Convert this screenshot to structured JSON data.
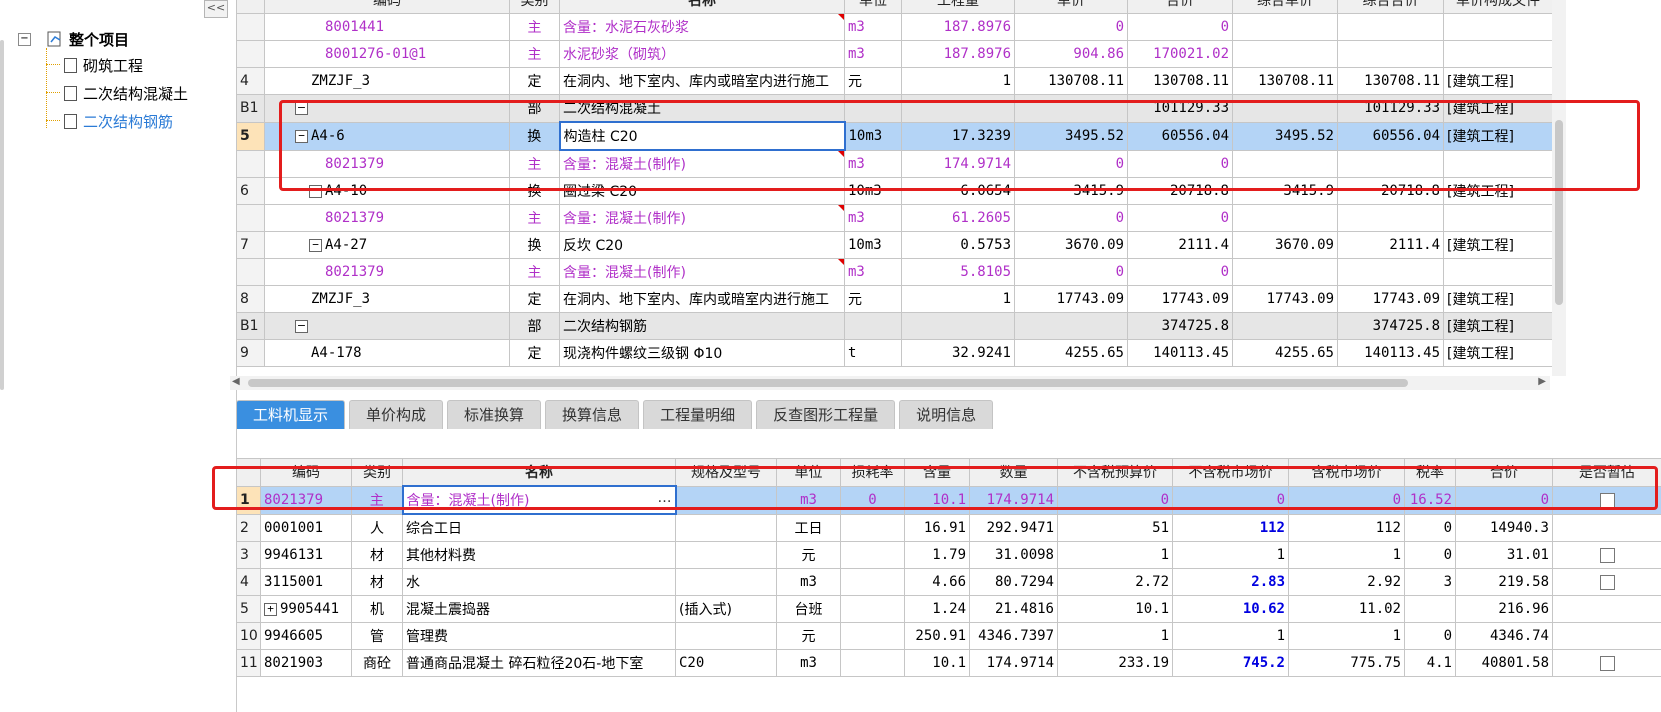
{
  "tree": {
    "collapse_label": "<<",
    "root_label": "整个项目",
    "root_toggle": "−",
    "children": [
      "砌筑工程",
      "二次结构混凝土",
      "二次结构钢筋"
    ]
  },
  "top_table": {
    "headers": [
      "编码",
      "类别",
      "名称",
      "单位",
      "工程量",
      "单价",
      "合价",
      "综合单价",
      "综合合价",
      "单价构成文件"
    ],
    "rows": [
      {
        "no": "",
        "code": "8001441",
        "type": "主",
        "name": "含量：水泥石灰砂浆",
        "unit": "m3",
        "qty": "187.8976",
        "price": "0",
        "total": "0",
        "cprice": "",
        "ctotal": "",
        "file": ""
      },
      {
        "no": "",
        "code": "8001276-01@1",
        "type": "主",
        "name": "水泥砂浆（砌筑）",
        "unit": "m3",
        "qty": "187.8976",
        "price": "904.86",
        "total": "170021.02",
        "cprice": "",
        "ctotal": "",
        "file": ""
      },
      {
        "no": "4",
        "code": "ZMZJF_3",
        "type": "定",
        "name": "在洞内、地下室内、库内或暗室内进行施工",
        "unit": "元",
        "qty": "1",
        "price": "130708.11",
        "total": "130708.11",
        "cprice": "130708.11",
        "ctotal": "130708.11",
        "file": "[建筑工程]"
      },
      {
        "no": "B1",
        "code": "",
        "type": "部",
        "name": "二次结构混凝土",
        "unit": "",
        "qty": "",
        "price": "",
        "total": "101129.33",
        "cprice": "",
        "ctotal": "101129.33",
        "file": "[建筑工程]"
      },
      {
        "no": "5",
        "code": "A4-6",
        "type": "换",
        "name": "构造柱 C20",
        "unit": "10m3",
        "qty": "17.3239",
        "price": "3495.52",
        "total": "60556.04",
        "cprice": "3495.52",
        "ctotal": "60556.04",
        "file": "[建筑工程]"
      },
      {
        "no": "",
        "code": "8021379",
        "type": "主",
        "name": "含量：混凝土(制作)",
        "unit": "m3",
        "qty": "174.9714",
        "price": "0",
        "total": "0",
        "cprice": "",
        "ctotal": "",
        "file": ""
      },
      {
        "no": "6",
        "code": "A4-10",
        "type": "换",
        "name": "圈过梁 C20",
        "unit": "10m3",
        "qty": "6.0654",
        "price": "3415.9",
        "total": "20718.8",
        "cprice": "3415.9",
        "ctotal": "20718.8",
        "file": "[建筑工程]"
      },
      {
        "no": "",
        "code": "8021379",
        "type": "主",
        "name": "含量：混凝土(制作)",
        "unit": "m3",
        "qty": "61.2605",
        "price": "0",
        "total": "0",
        "cprice": "",
        "ctotal": "",
        "file": ""
      },
      {
        "no": "7",
        "code": "A4-27",
        "type": "换",
        "name": "反坎 C20",
        "unit": "10m3",
        "qty": "0.5753",
        "price": "3670.09",
        "total": "2111.4",
        "cprice": "3670.09",
        "ctotal": "2111.4",
        "file": "[建筑工程]"
      },
      {
        "no": "",
        "code": "8021379",
        "type": "主",
        "name": "含量：混凝土(制作)",
        "unit": "m3",
        "qty": "5.8105",
        "price": "0",
        "total": "0",
        "cprice": "",
        "ctotal": "",
        "file": ""
      },
      {
        "no": "8",
        "code": "ZMZJF_3",
        "type": "定",
        "name": "在洞内、地下室内、库内或暗室内进行施工",
        "unit": "元",
        "qty": "1",
        "price": "17743.09",
        "total": "17743.09",
        "cprice": "17743.09",
        "ctotal": "17743.09",
        "file": "[建筑工程]"
      },
      {
        "no": "B1",
        "code": "",
        "type": "部",
        "name": "二次结构钢筋",
        "unit": "",
        "qty": "",
        "price": "",
        "total": "374725.8",
        "cprice": "",
        "ctotal": "374725.8",
        "file": "[建筑工程]"
      },
      {
        "no": "9",
        "code": "A4-178",
        "type": "定",
        "name": "现浇构件螺纹三级钢 Φ10",
        "unit": "t",
        "qty": "32.9241",
        "price": "4255.65",
        "total": "140113.45",
        "cprice": "4255.65",
        "ctotal": "140113.45",
        "file": "[建筑工程]"
      }
    ]
  },
  "tabs": [
    "工料机显示",
    "单价构成",
    "标准换算",
    "换算信息",
    "工程量明细",
    "反查图形工程量",
    "说明信息"
  ],
  "bottom_table": {
    "headers": [
      "编码",
      "类别",
      "名称",
      "规格及型号",
      "单位",
      "损耗率",
      "含量",
      "数量",
      "不含税预算价",
      "不含税市场价",
      "含税市场价",
      "税率",
      "合价",
      "是否暂估"
    ],
    "rows": [
      {
        "no": "1",
        "code": "8021379",
        "type": "主",
        "name": "含量：混凝土(制作)",
        "spec": "",
        "unit": "m3",
        "loss": "0",
        "content": "10.1",
        "qty": "174.9714",
        "budget": "0",
        "market": "0",
        "tax_market": "0",
        "tax": "16.52",
        "total": "0",
        "check": true
      },
      {
        "no": "2",
        "code": "0001001",
        "type": "人",
        "name": "综合工日",
        "spec": "",
        "unit": "工日",
        "loss": "",
        "content": "16.91",
        "qty": "292.9471",
        "budget": "51",
        "market": "112",
        "tax_market": "112",
        "tax": "0",
        "total": "14940.3",
        "check": false
      },
      {
        "no": "3",
        "code": "9946131",
        "type": "材",
        "name": "其他材料费",
        "spec": "",
        "unit": "元",
        "loss": "",
        "content": "1.79",
        "qty": "31.0098",
        "budget": "1",
        "market": "1",
        "tax_market": "1",
        "tax": "0",
        "total": "31.01",
        "check": true
      },
      {
        "no": "4",
        "code": "3115001",
        "type": "材",
        "name": "水",
        "spec": "",
        "unit": "m3",
        "loss": "",
        "content": "4.66",
        "qty": "80.7294",
        "budget": "2.72",
        "market": "2.83",
        "tax_market": "2.92",
        "tax": "3",
        "total": "219.58",
        "check": true
      },
      {
        "no": "5",
        "code": "9905441",
        "type": "机",
        "name": "混凝土震捣器",
        "spec": "(插入式)",
        "unit": "台班",
        "loss": "",
        "content": "1.24",
        "qty": "21.4816",
        "budget": "10.1",
        "market": "10.62",
        "tax_market": "11.02",
        "tax": "",
        "total": "216.96",
        "check": false
      },
      {
        "no": "10",
        "code": "9946605",
        "type": "管",
        "name": "管理费",
        "spec": "",
        "unit": "元",
        "loss": "",
        "content": "250.91",
        "qty": "4346.7397",
        "budget": "1",
        "market": "1",
        "tax_market": "1",
        "tax": "0",
        "total": "4346.74",
        "check": false
      },
      {
        "no": "11",
        "code": "8021903",
        "type": "商砼",
        "name": "普通商品混凝土 碎石粒径20石-地下室",
        "spec": "C20",
        "unit": "m3",
        "loss": "",
        "content": "10.1",
        "qty": "174.9714",
        "budget": "233.19",
        "market": "745.2",
        "tax_market": "775.75",
        "tax": "4.1",
        "total": "40801.58",
        "check": true
      }
    ]
  },
  "colors": {
    "highlight_red": "#e31d1d",
    "selection_blue": "#b4d4f6",
    "tab_active": "#3a8fe0",
    "main_material_purple": "#b030c8"
  }
}
